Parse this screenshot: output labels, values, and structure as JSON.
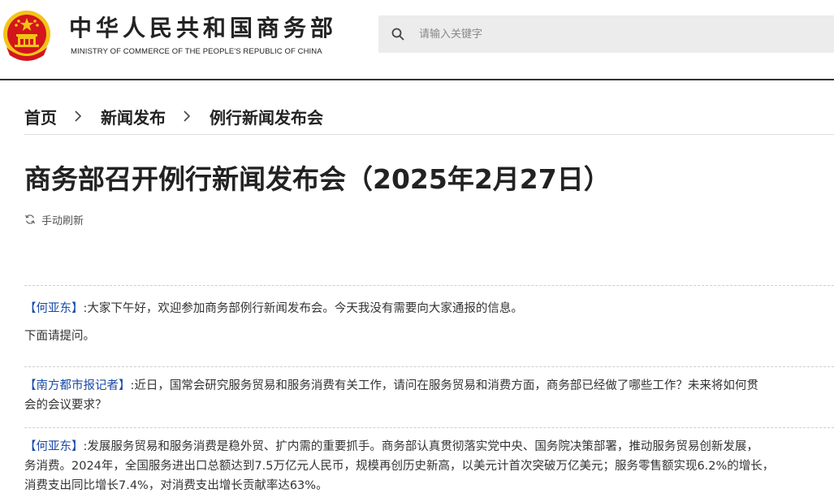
{
  "header": {
    "site_name_cn": "中华人民共和国商务部",
    "site_name_en": "MINISTRY OF COMMERCE OF THE PEOPLE'S REPUBLIC OF CHINA",
    "emblem_icon": "national-emblem-icon",
    "search": {
      "placeholder": "请输入关键字",
      "icon": "search-icon"
    }
  },
  "breadcrumb": [
    "首页",
    "新闻发布",
    "例行新闻发布会"
  ],
  "article": {
    "title": "商务部召开例行新闻发布会（2025年2月27日）",
    "refresh_label": "手动刷新",
    "entries": [
      {
        "speaker": "【何亚东】",
        "lines": [
          ":大家下午好，欢迎参加商务部例行新闻发布会。今天我没有需要向大家通报的信息。",
          "下面请提问。"
        ]
      },
      {
        "speaker": "【南方都市报记者】",
        "lines": [
          ":近日，国常会研究服务贸易和服务消费有关工作，请问在服务贸易和消费方面，商务部已经做了哪些工作？未来将如何贯",
          "会的会议要求？"
        ]
      },
      {
        "speaker": "【何亚东】",
        "lines": [
          ":发展服务贸易和服务消费是稳外贸、扩内需的重要抓手。商务部认真贯彻落实党中央、国务院决策部署，推动服务贸易创新发展，",
          "务消费。2024年，全国服务进出口总额达到7.5万亿元人民币，规模再创历史新高，以美元计首次突破万亿美元；服务零售额实现6.2%的增长，",
          "消费支出同比增长7.4%，对消费支出增长贡献率达63%。"
        ]
      }
    ]
  },
  "colors": {
    "speaker": "#1a4aa8",
    "emblem_red": "#d3151c",
    "emblem_gold": "#f3c318"
  }
}
